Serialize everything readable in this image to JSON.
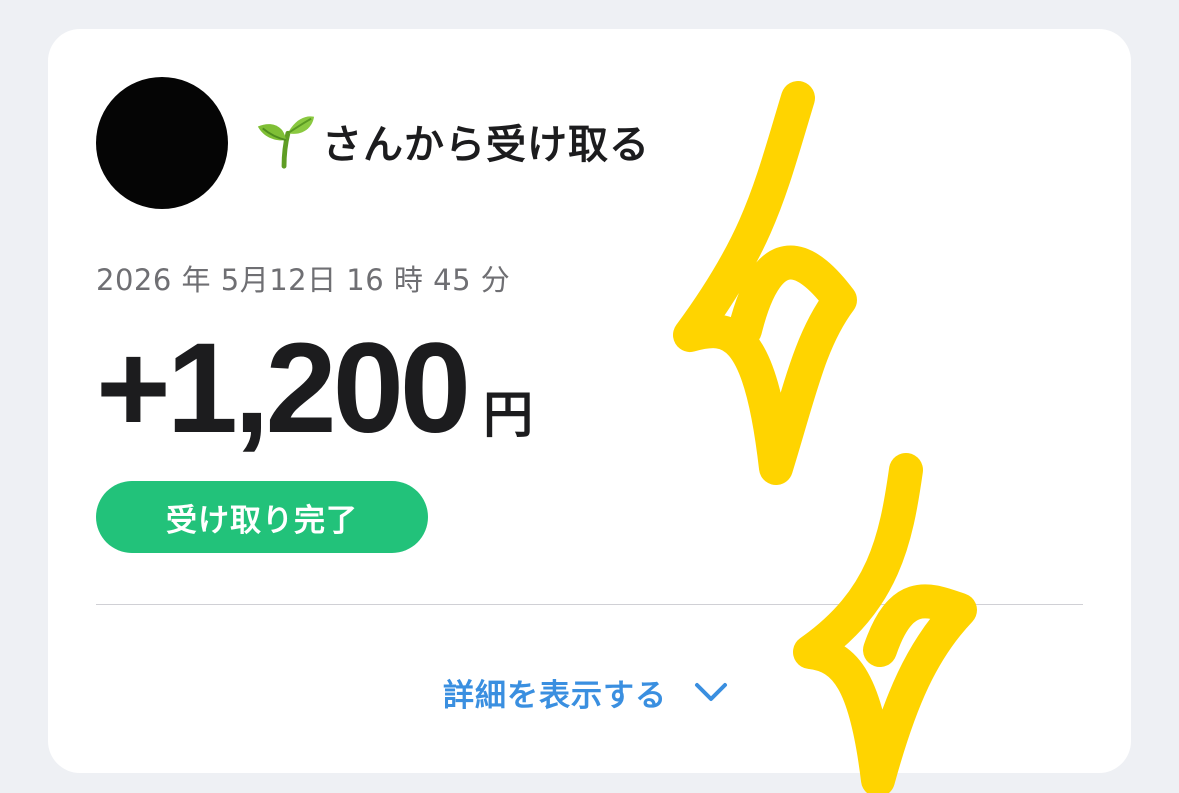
{
  "sender": {
    "avatar_icon": "sender-avatar",
    "name_icon": "seedling-icon",
    "title": "さんから受け取る"
  },
  "transaction": {
    "datetime": "2026 年 5月12日 16 時 45 分",
    "amount": "+1,200",
    "currency": "円",
    "status": "受け取り完了"
  },
  "details": {
    "label": "詳細を表示する",
    "icon": "chevron-down-icon"
  },
  "colors": {
    "status_green": "#22c27a",
    "link_blue": "#3a8fe0",
    "sparkle_yellow": "#ffd400"
  },
  "annotations": {
    "overlay": "sparkle-drawing"
  }
}
